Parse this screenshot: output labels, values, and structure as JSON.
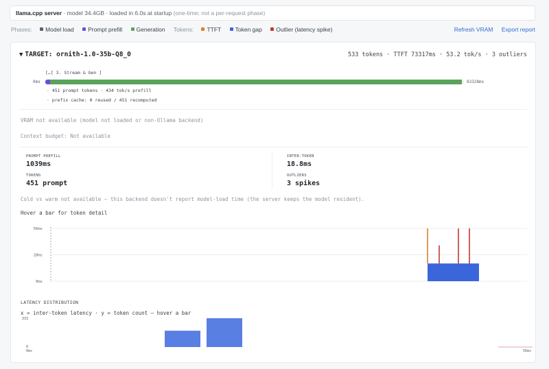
{
  "banner": {
    "server": "llama.cpp server",
    "detail": " · model 34.4GB · loaded in 6.0s at startup ",
    "note": "(one-time; not a per-request phase)"
  },
  "legend": {
    "phases_label": "Phases:",
    "phases": [
      {
        "label": "Model load",
        "color": "#5b6168"
      },
      {
        "label": "Prompt prefill",
        "color": "#6b4fd8"
      },
      {
        "label": "Generation",
        "color": "#5aa35a"
      }
    ],
    "tokens_label": "Tokens:",
    "tokens": [
      {
        "label": "TTFT",
        "color": "#d9822b"
      },
      {
        "label": "Token gap",
        "color": "#3b66db"
      },
      {
        "label": "Outlier (latency spike)",
        "color": "#c0392b"
      }
    ]
  },
  "actions": {
    "refresh": "Refresh VRAM",
    "export": "Export report"
  },
  "target": {
    "title": "TARGET: ornith-1.0-35b-Q8_0",
    "stats": "533 tokens · TTFT 73317ms · 53.2 tok/s · 3 outliers"
  },
  "timeline": {
    "stage_label": "[…[ 3. Stream & Gen ]",
    "start": "0ms",
    "end": "83328ms",
    "prefill_fraction": 0.013,
    "generation_fraction": 0.987,
    "note1": "· 451 prompt tokens · 434 tok/s prefill",
    "note2": "· prefix cache: 0 reused / 451 recomputed"
  },
  "messages": {
    "vram": "VRAM not available (model not loaded or non-Ollama backend)",
    "context": "Context budget: Not available",
    "cold_warm": "Cold vs warm not available — this backend doesn't report model-load time (the server keeps the model resident).",
    "hover": "Hover a bar for token detail"
  },
  "metrics": {
    "prefill_label": "PROMPT PREFILL",
    "prefill_value": "1039ms",
    "inter_label": "INTER-TOKEN",
    "inter_value": "18.8ms",
    "tokens_label": "TOKENS",
    "tokens_value": "451 prompt",
    "outliers_label": "OUTLIERS",
    "outliers_value": "3 spikes"
  },
  "chart_data": [
    {
      "type": "bar",
      "title": "",
      "y_ticks": [
        "56ms",
        "28ms",
        "0ms"
      ],
      "ylim": [
        0,
        56
      ],
      "baseline_ms": 18.8,
      "spikes_ms": [
        56,
        38,
        56,
        56
      ],
      "spike_colors": [
        "#d9822b",
        "#c0392b",
        "#c0392b",
        "#c0392b"
      ],
      "grid": true
    },
    {
      "type": "bar",
      "title": "LATENCY DISTRIBUTION",
      "subtitle": "x = inter-token latency · y = token count — hover a bar",
      "y_ticks": [
        "333",
        "0"
      ],
      "x_ticks": [
        "0ms",
        "56ms"
      ],
      "ylim": [
        0,
        333
      ],
      "bars": [
        {
          "x_range_ms": [
            11.5,
            15.0
          ],
          "count": 189
        },
        {
          "x_range_ms": [
            15.0,
            19.0
          ],
          "count": 333
        }
      ]
    }
  ]
}
